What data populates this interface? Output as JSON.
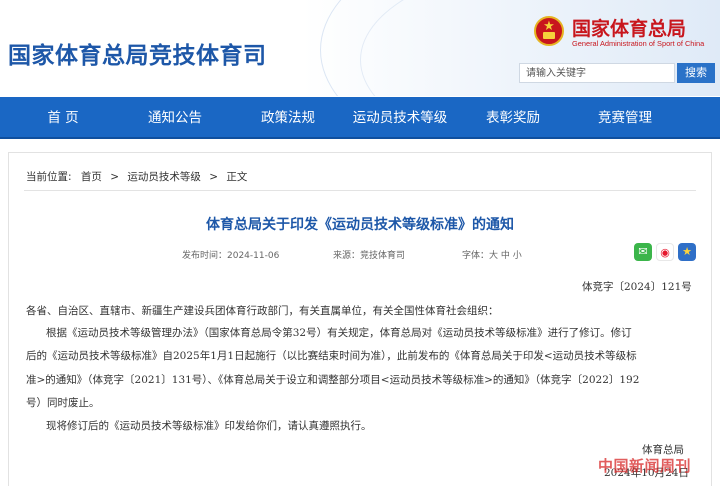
{
  "header": {
    "site_title": "国家体育总局竞技体育司",
    "org_name_cn": "国家体育总局",
    "org_name_en": "General Administration of Sport of China",
    "search": {
      "placeholder": "请输入关键字",
      "button_label": "搜索"
    }
  },
  "nav": {
    "items": [
      "首 页",
      "通知公告",
      "政策法规",
      "运动员技术等级",
      "表彰奖励",
      "竞赛管理"
    ]
  },
  "breadcrumb": {
    "label": "当前位置:",
    "items": [
      "首页",
      "运动员技术等级",
      "正文"
    ],
    "separator": ">"
  },
  "article": {
    "title": "体育总局关于印发《运动员技术等级标准》的通知",
    "meta": {
      "date": "发布时间：2024-11-06",
      "source": "来源：竞技体育司",
      "font_size": "字体：大  中  小"
    },
    "doc_number": "体竞字〔2024〕121号",
    "addressee": "各省、自治区、直辖市、新疆生产建设兵团体育行政部门，有关直属单位，有关全国性体育社会组织：",
    "paragraph_lines": [
      "根据《运动员技术等级管理办法》（国家体育总局令第32号）有关规定，体育总局对《运动员技术等级标准》进行了修订。修订",
      "后的《运动员技术等级标准》自2025年1月1日起施行（以比赛结束时间为准），此前发布的《体育总局关于印发<运动员技术等级标",
      "准>的通知》（体竞字〔2021〕131号）、《体育总局关于设立和调整部分项目<运动员技术等级标准>的通知》（体竞字〔2022〕192",
      "号）同时废止。"
    ],
    "closing": "现将修订后的《运动员技术等级标准》印发给你们，请认真遵照执行。",
    "signature": "体育总局",
    "signature_date": "2024年10月24日"
  },
  "share": {
    "icons": [
      "wechat-icon",
      "weibo-icon",
      "favorite-icon"
    ]
  },
  "watermark": "中国新闻周刊",
  "colors": {
    "brand_blue": "#1d57a8",
    "nav_blue": "#1a67c4",
    "emblem_red": "#c8161d",
    "search_button": "#2a72c8",
    "wechat_green": "#3bb54a",
    "weibo_red": "#e6162d"
  }
}
